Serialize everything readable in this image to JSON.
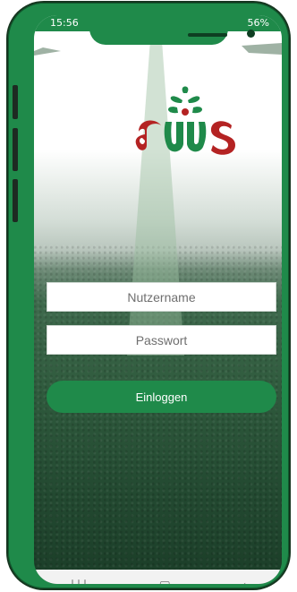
{
  "status_bar": {
    "time": "15:56",
    "battery": "56%"
  },
  "login": {
    "username_placeholder": "Nutzername",
    "password_placeholder": "Passwort",
    "button_label": "Einloggen"
  },
  "nav": {
    "recent_icon": "recent-apps-icon",
    "home_icon": "home-icon",
    "back_icon": "back-icon"
  },
  "colors": {
    "accent_green": "#1f8a4a",
    "logo_red": "#b42323"
  }
}
